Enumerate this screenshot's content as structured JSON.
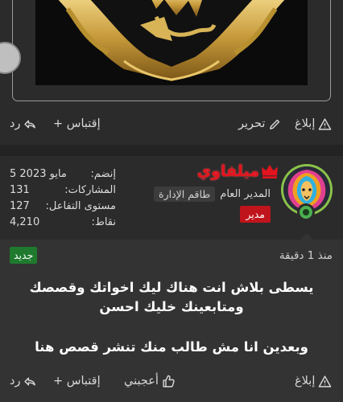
{
  "post_top": {
    "actions": {
      "report": "إبلاغ",
      "edit": "تحرير",
      "quote": "+ إقتباس",
      "reply": "رد"
    }
  },
  "user": {
    "name": "ميلفاوي",
    "title": "المدير العام",
    "team_badge": "طاقم الإدارة",
    "role_badge": "مدير",
    "stats": [
      {
        "label": "إنضم:",
        "value": "5 مايو 2023"
      },
      {
        "label": "المشاركات:",
        "value": "131"
      },
      {
        "label": "مستوى التفاعل:",
        "value": "127"
      },
      {
        "label": "نقاط:",
        "value": "4,210"
      }
    ]
  },
  "post": {
    "time": "منذ 1 دقيقة",
    "new_badge": "جديد",
    "lines": [
      "يسطى بلاش انت هناك ليك اخواتك وقصصك",
      "ومتابعينك خليك احسن",
      "وبعدين انا مش طالب منك تنشر قصص هنا"
    ],
    "actions": {
      "report": "إبلاغ",
      "like": "أعجبني",
      "quote": "+ إقتباس",
      "reply": "رد"
    }
  },
  "colors": {
    "accent_green": "#8bc34a",
    "manager_red": "#c0141c",
    "username_red": "#e3141e",
    "new_green": "#1f7a2e"
  }
}
